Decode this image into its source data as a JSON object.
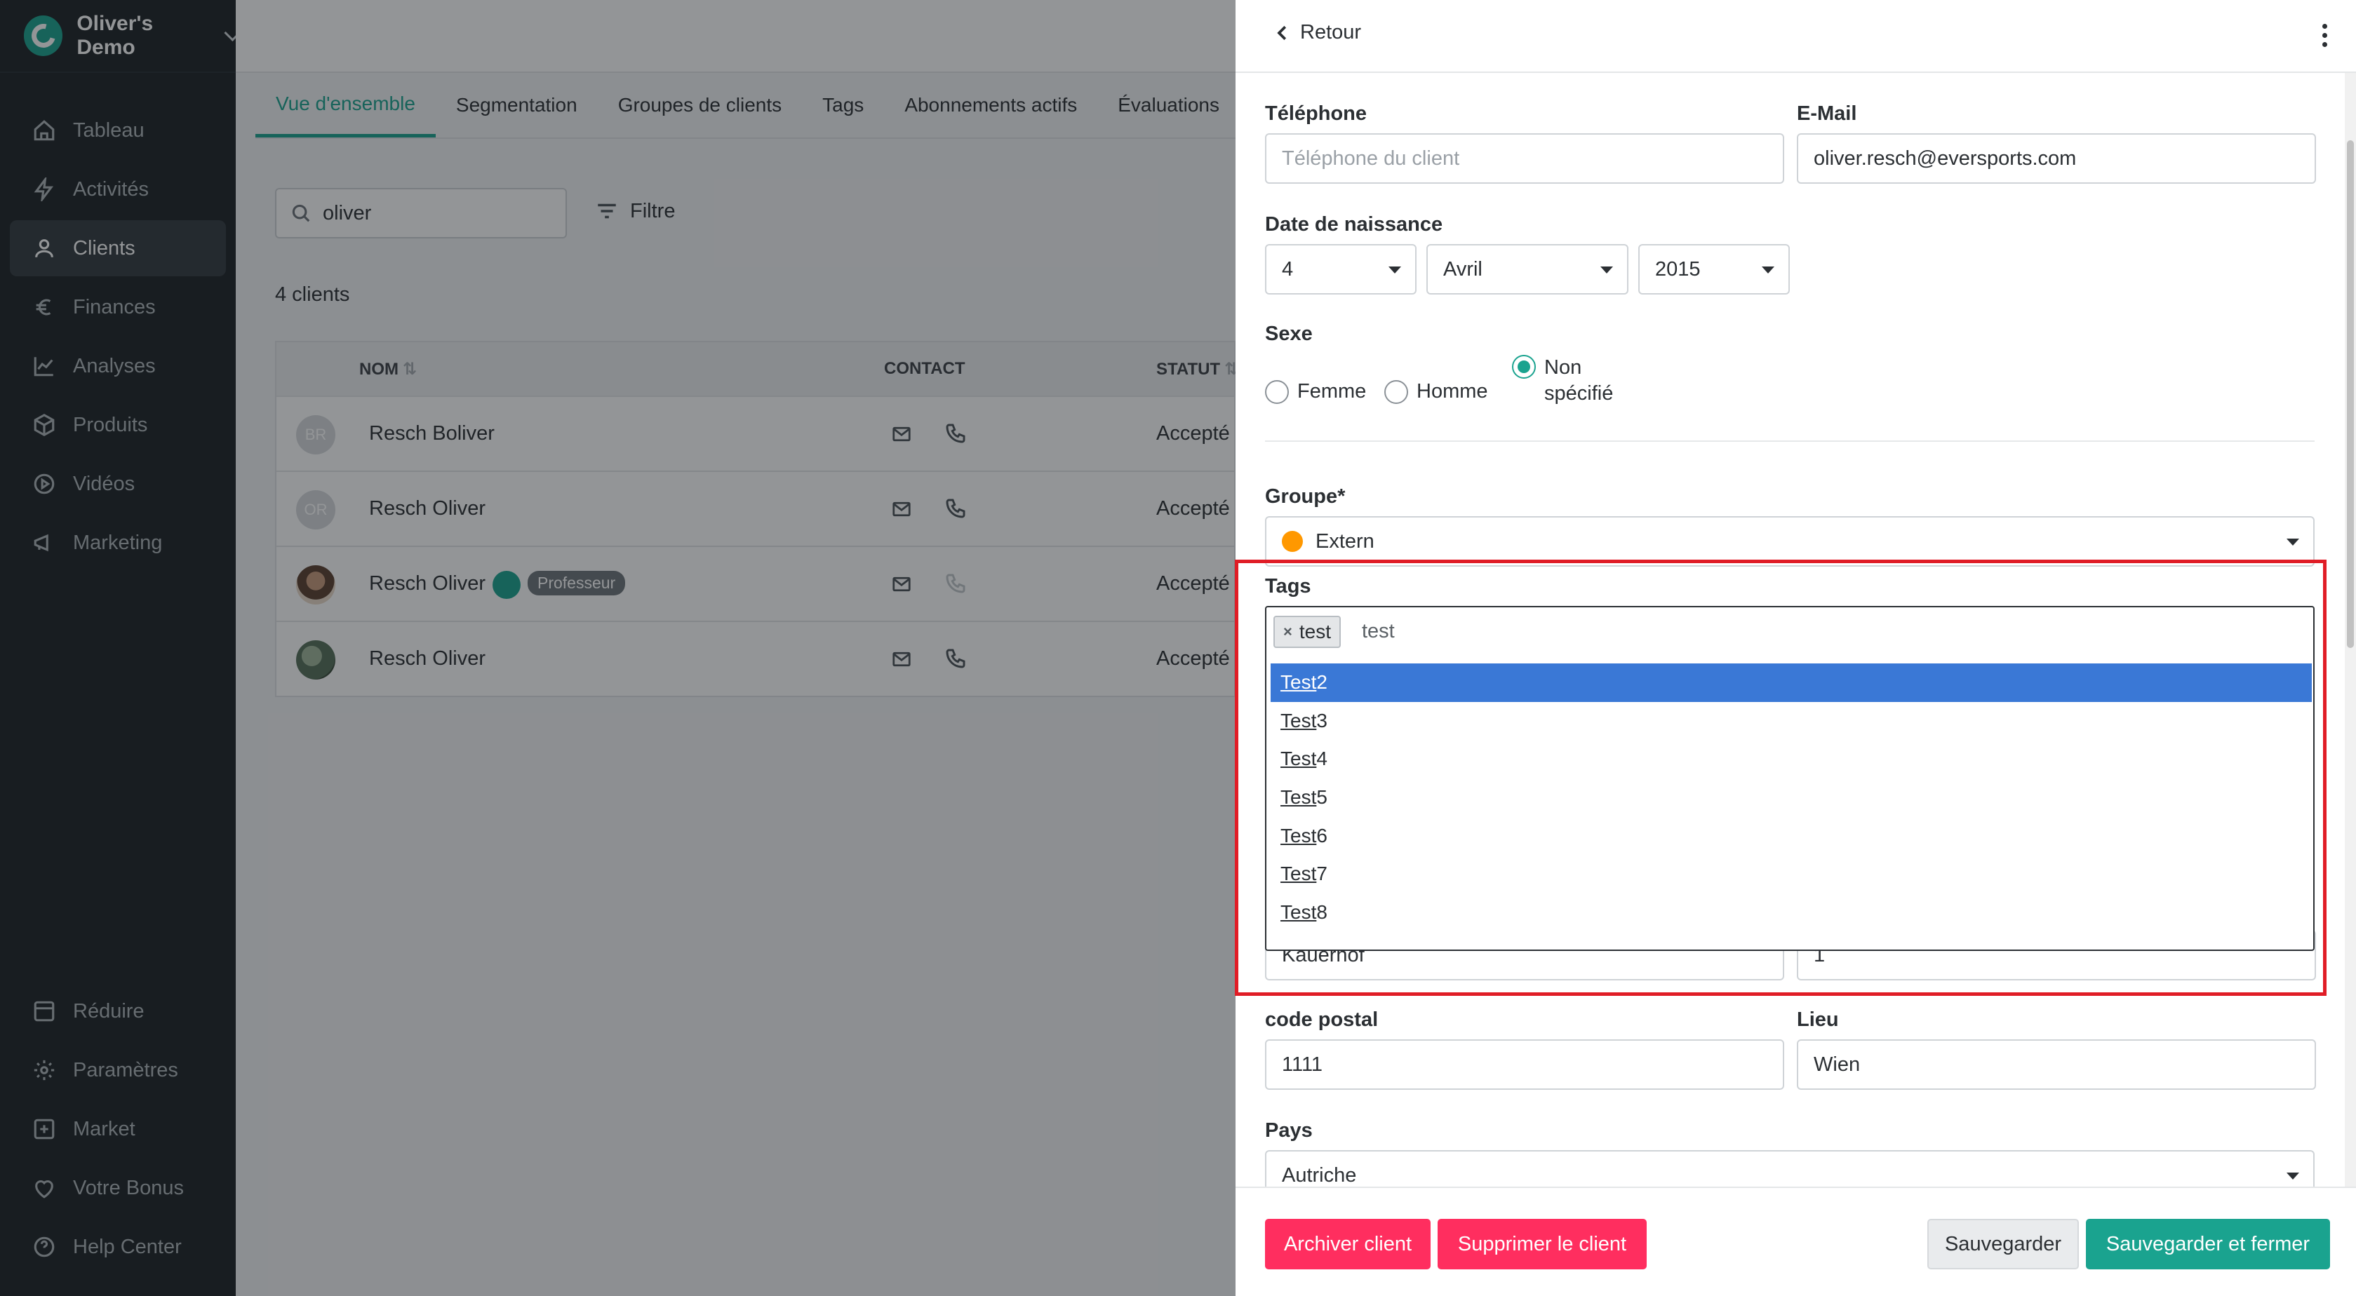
{
  "brand": {
    "name": "Oliver's Demo"
  },
  "sidebar": {
    "items": [
      {
        "label": "Tableau",
        "icon": "home-icon"
      },
      {
        "label": "Activités",
        "icon": "bolt-icon"
      },
      {
        "label": "Clients",
        "icon": "user-icon",
        "active": true
      },
      {
        "label": "Finances",
        "icon": "euro-icon"
      },
      {
        "label": "Analyses",
        "icon": "chart-icon"
      },
      {
        "label": "Produits",
        "icon": "box-icon"
      },
      {
        "label": "Vidéos",
        "icon": "play-icon"
      },
      {
        "label": "Marketing",
        "icon": "megaphone-icon"
      }
    ],
    "bottom_items": [
      {
        "label": "Réduire",
        "icon": "collapse-icon"
      },
      {
        "label": "Paramètres",
        "icon": "gear-icon"
      },
      {
        "label": "Market",
        "icon": "plus-square-icon"
      },
      {
        "label": "Votre Bonus",
        "icon": "heart-icon"
      },
      {
        "label": "Help Center",
        "icon": "help-icon"
      }
    ]
  },
  "main": {
    "tabs": [
      "Vue d'ensemble",
      "Segmentation",
      "Groupes de clients",
      "Tags",
      "Abonnements actifs",
      "Évaluations"
    ],
    "search_value": "oliver",
    "filter_label": "Filtre",
    "count_text": "4 clients",
    "table": {
      "headers": {
        "name": "NOM",
        "contact": "CONTACT",
        "status": "STATUT"
      },
      "rows": [
        {
          "initials": "BR",
          "name": "Resch Boliver",
          "status": "Accepté"
        },
        {
          "initials": "OR",
          "name": "Resch Oliver",
          "status": "Accepté"
        },
        {
          "initials": "",
          "name": "Resch Oliver",
          "badge": "Professeur",
          "status": "Accepté"
        },
        {
          "initials": "",
          "name": "Resch Oliver",
          "status": "Accepté"
        }
      ]
    }
  },
  "drawer": {
    "back_label": "Retour",
    "phone": {
      "label": "Téléphone",
      "placeholder": "Téléphone du client"
    },
    "email": {
      "label": "E-Mail",
      "value": "oliver.resch@eversports.com"
    },
    "birthdate": {
      "label": "Date de naissance",
      "day": "4",
      "month": "Avril",
      "year": "2015"
    },
    "gender": {
      "label": "Sexe",
      "options": [
        "Femme",
        "Homme",
        "Non spécifié"
      ],
      "selected": "Non spécifié"
    },
    "group": {
      "label": "Groupe*",
      "value": "Extern",
      "color": "#ff9800"
    },
    "tags": {
      "label": "Tags",
      "selected_chip": "test",
      "typed": "test",
      "options": [
        {
          "match": "Test",
          "rest": " 2"
        },
        {
          "match": "Test",
          "rest": " 3"
        },
        {
          "match": "Test",
          "rest": " 4"
        },
        {
          "match": "Test",
          "rest": " 5"
        },
        {
          "match": "Test",
          "rest": " 6"
        },
        {
          "match": "Test",
          "rest": " 7"
        },
        {
          "match": "Test",
          "rest": " 8"
        }
      ]
    },
    "street_value": "Kauerhof",
    "number_value": "1",
    "postal": {
      "label": "code postal",
      "value": "1111"
    },
    "city": {
      "label": "Lieu",
      "value": "Wien"
    },
    "country": {
      "label": "Pays",
      "value": "Autriche"
    },
    "buttons": {
      "archive": "Archiver client",
      "delete": "Supprimer le client",
      "save": "Sauvegarder",
      "save_close": "Sauvegarder et fermer"
    }
  },
  "colors": {
    "accent": "#1aa38f",
    "danger": "#ff2e5f",
    "highlight": "#3a78d6",
    "annotation": "#e01d26"
  }
}
